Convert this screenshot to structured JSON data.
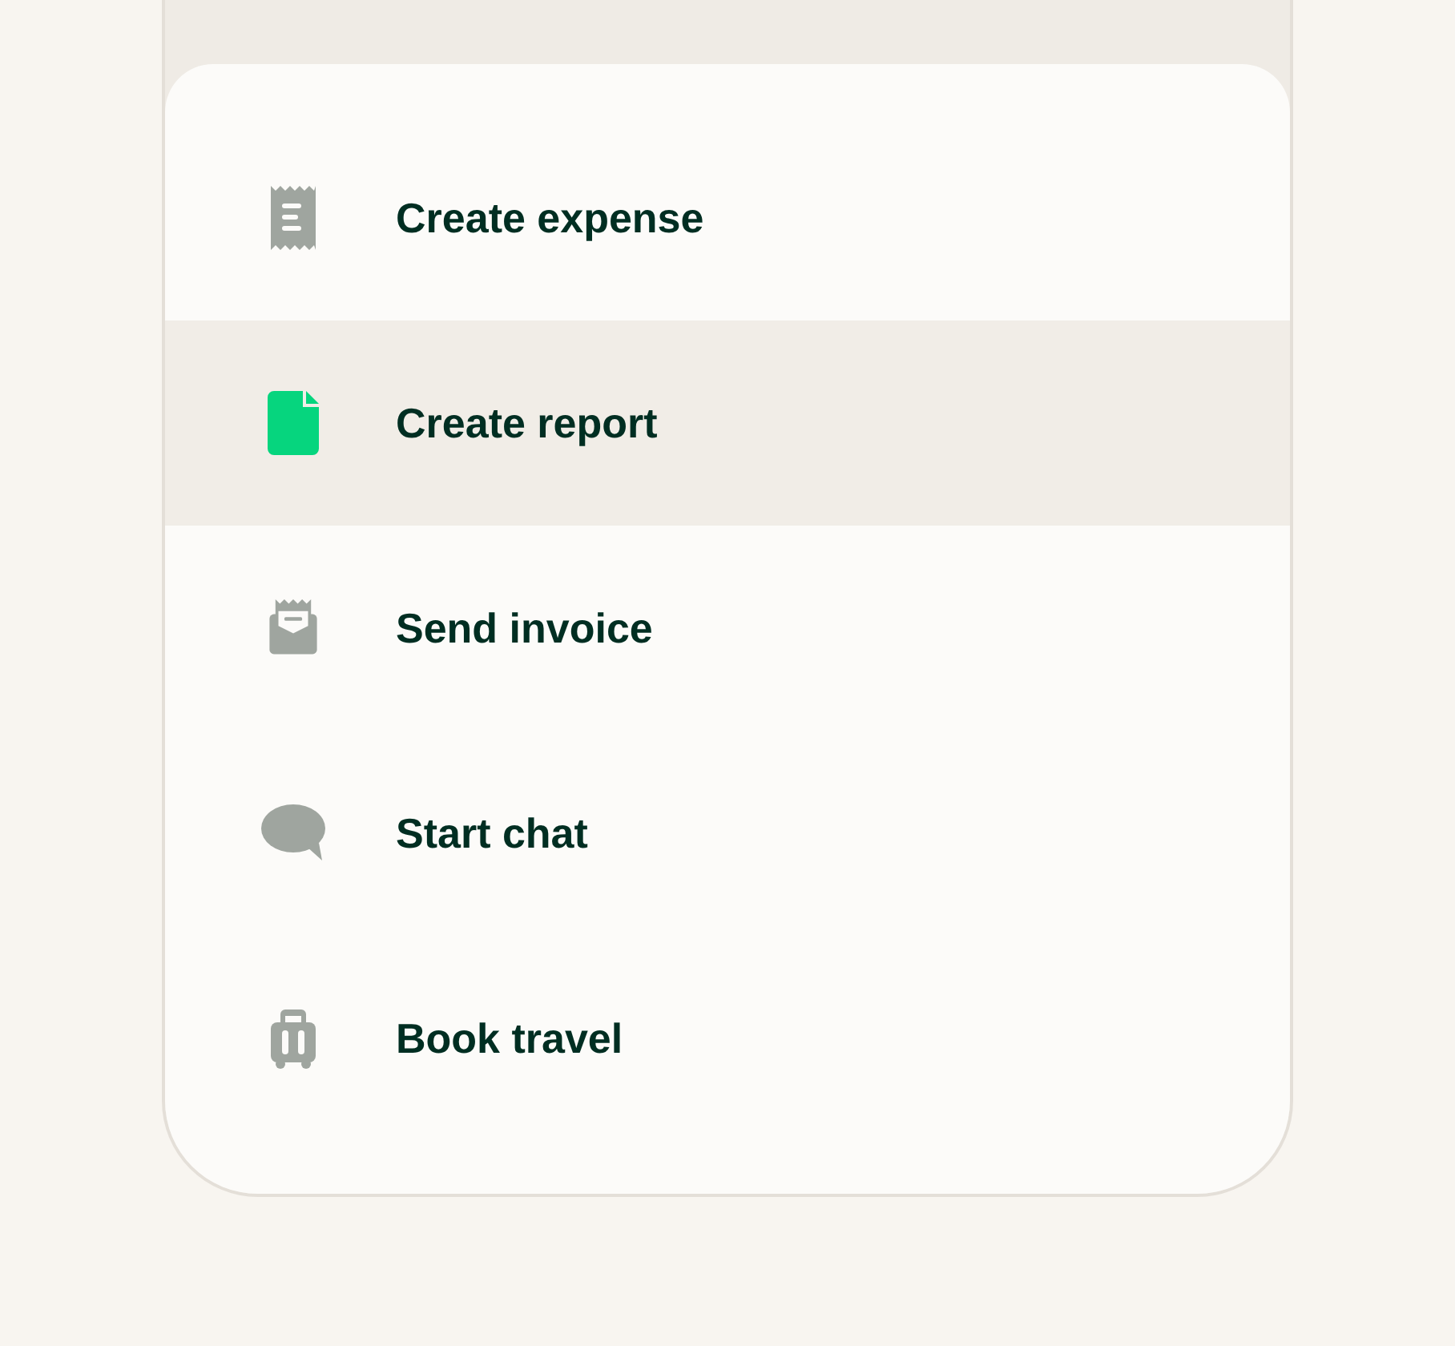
{
  "menu": [
    {
      "kind": "receipt",
      "label": "Create expense",
      "selected": false
    },
    {
      "kind": "document",
      "label": "Create report",
      "selected": true
    },
    {
      "kind": "invoice",
      "label": "Send invoice",
      "selected": false
    },
    {
      "kind": "chat",
      "label": "Start chat",
      "selected": false
    },
    {
      "kind": "luggage",
      "label": "Book travel",
      "selected": false
    }
  ]
}
